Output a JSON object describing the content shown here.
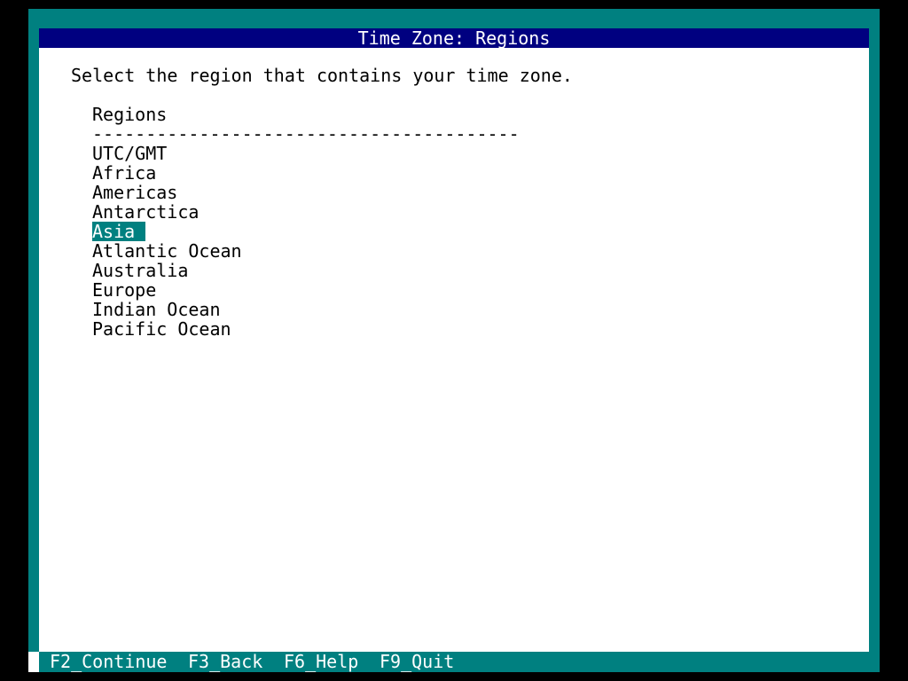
{
  "window": {
    "title": "Time Zone: Regions"
  },
  "instruction": "Select the region that contains your time zone.",
  "list": {
    "header": "Regions",
    "divider": "----------------------------------------",
    "items": [
      "UTC/GMT",
      "Africa",
      "Americas",
      "Antarctica",
      "Asia",
      "Atlantic Ocean",
      "Australia",
      "Europe",
      "Indian Ocean",
      "Pacific Ocean"
    ],
    "selected": "Asia"
  },
  "function_keys": [
    "F2_Continue",
    "F3_Back",
    "F6_Help",
    "F9_Quit"
  ],
  "colors": {
    "frame": "#008080",
    "title_bar": "#000080",
    "selection": "#008080",
    "background": "#000000",
    "window": "#ffffff"
  }
}
